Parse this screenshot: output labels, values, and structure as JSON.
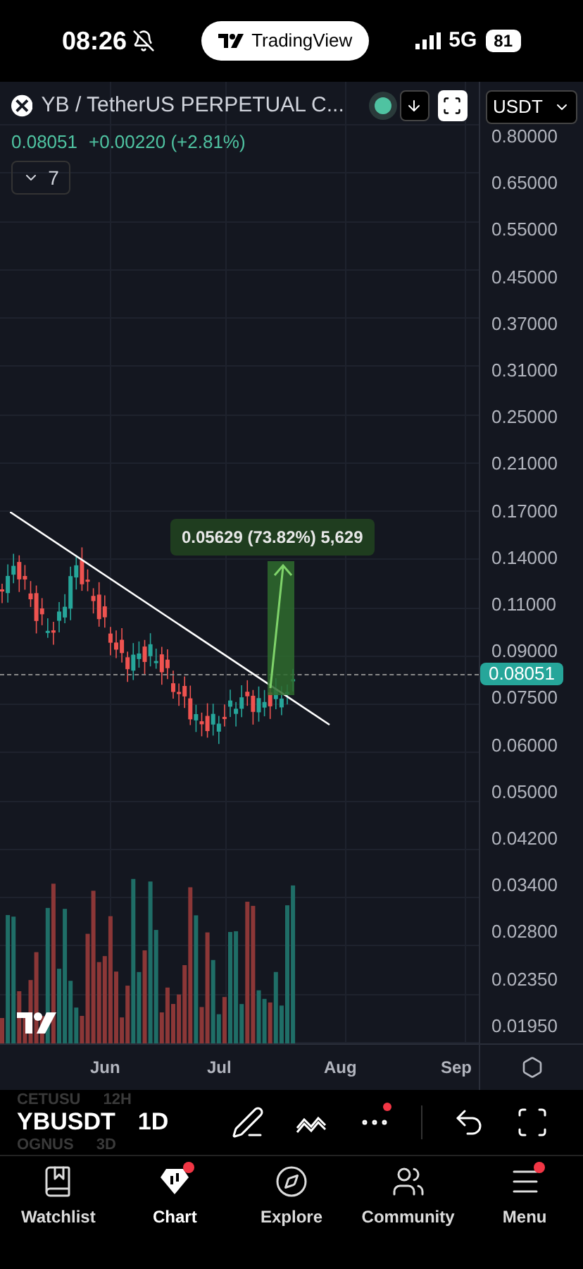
{
  "status_bar": {
    "time": "08:26",
    "app_pill": "TradingView",
    "network": "5G",
    "battery": "81"
  },
  "header": {
    "title": "YB / TetherUS PERPETUAL C...",
    "live_dot": {
      "color": "#4fc3a1"
    },
    "currency": "USDT",
    "last_price": "0.08051",
    "change": "+0.00220 (+2.81%)",
    "indicators_count": "7"
  },
  "price_axis": {
    "labels": [
      "0.80000",
      "0.65000",
      "0.55000",
      "0.45000",
      "0.37000",
      "0.31000",
      "0.25000",
      "0.21000",
      "0.17000",
      "0.14000",
      "0.11000",
      "0.09000",
      "0.07500",
      "0.06000",
      "0.05000",
      "0.04200",
      "0.03400",
      "0.02800",
      "0.02350",
      "0.01950"
    ],
    "current_price": "0.08051"
  },
  "measure": {
    "label": "0.05629 (73.82%) 5,629"
  },
  "time_axis": [
    "Jun",
    "Jul",
    "Aug",
    "Sep"
  ],
  "symbol_picker": {
    "above": [
      "CETUSU",
      "12H"
    ],
    "current": [
      "YBUSDT",
      "1D"
    ],
    "below": [
      "OGNUS",
      "3D"
    ]
  },
  "toolbar": [
    {
      "kind": "draw",
      "badge": false
    },
    {
      "kind": "lines",
      "badge": false
    },
    {
      "kind": "more",
      "badge": true
    },
    {
      "kind": "undo",
      "badge": false
    },
    {
      "kind": "fullscreen",
      "badge": false
    }
  ],
  "nav": [
    {
      "kind": "watchlist",
      "label": "Watchlist",
      "selected": false,
      "badge": false
    },
    {
      "kind": "chart",
      "label": "Chart",
      "selected": true,
      "badge": true
    },
    {
      "kind": "explore",
      "label": "Explore",
      "selected": false,
      "badge": false
    },
    {
      "kind": "community",
      "label": "Community",
      "selected": false,
      "badge": false
    },
    {
      "kind": "menu",
      "label": "Menu",
      "selected": false,
      "badge": true
    }
  ]
}
